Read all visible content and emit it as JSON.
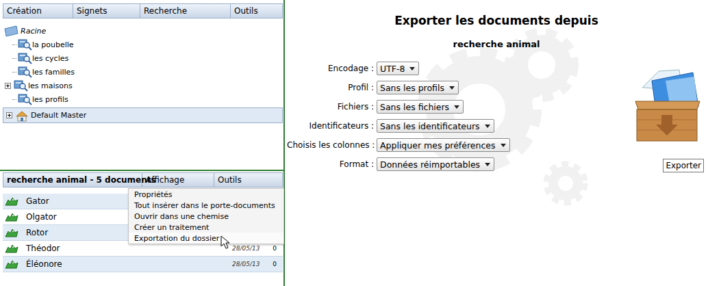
{
  "top_menu": [
    "Création",
    "Signets",
    "Recherche",
    "Outils"
  ],
  "tree": {
    "root": "Racine",
    "items": [
      {
        "label": "la poubelle",
        "expandable": false,
        "expanded": false
      },
      {
        "label": "les cycles",
        "expandable": false,
        "expanded": false
      },
      {
        "label": "les familles",
        "expandable": false,
        "expanded": false
      },
      {
        "label": "les maisons",
        "expandable": true,
        "expanded": false
      },
      {
        "label": "les profils",
        "expandable": false,
        "expanded": false
      }
    ],
    "master": {
      "label": "Default Master",
      "expanded": false,
      "selected": true
    }
  },
  "results": {
    "title": "recherche animal - 5 documents",
    "menu": [
      "Affichage",
      "Outils"
    ],
    "rows": [
      {
        "name": "Gator"
      },
      {
        "name": "Olgator"
      },
      {
        "name": "Rotor"
      },
      {
        "name": "Théodor",
        "date": "28/05/13",
        "count": "0"
      },
      {
        "name": "Éléonore",
        "date": "28/05/13",
        "count": "0"
      }
    ]
  },
  "context_menu": {
    "items": [
      {
        "label": "Propriétés",
        "highlighted": false
      },
      {
        "label": "Tout insérer dans le porte-documents",
        "highlighted": false
      },
      {
        "label": "Ouvrir dans une chemise",
        "highlighted": false
      },
      {
        "label": "Créer un traitement",
        "highlighted": false
      },
      {
        "label": "Exportation du dossier",
        "highlighted": true
      }
    ]
  },
  "export": {
    "title": "Exporter les documents depuis",
    "subtitle": "recherche animal",
    "fields": [
      {
        "label": "Encodage :",
        "value": "UTF-8"
      },
      {
        "label": "Profil :",
        "value": "Sans les profils"
      },
      {
        "label": "Fichiers :",
        "value": "Sans les fichiers"
      },
      {
        "label": "Identificateurs :",
        "value": "Sans les identificateurs"
      },
      {
        "label": "Choisis les colonnes :",
        "value": "Appliquer mes préférences"
      },
      {
        "label": "Format :",
        "value": "Données réimportables"
      }
    ],
    "button": "Exporter"
  }
}
